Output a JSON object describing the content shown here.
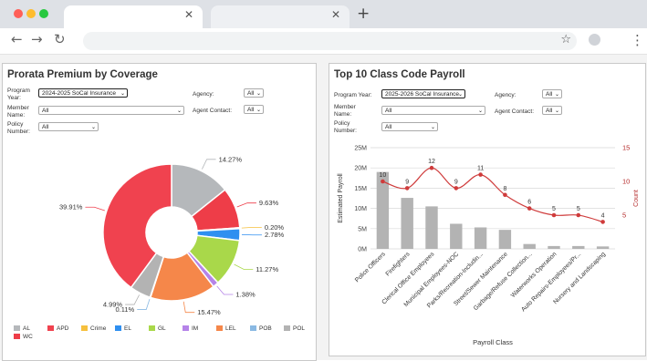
{
  "browser": {
    "tabs": [
      {
        "label": ""
      },
      {
        "label": ""
      }
    ],
    "address": "",
    "colors": {
      "close": "#ff5f57",
      "minimize": "#febc2e",
      "maximize": "#28c840"
    }
  },
  "left_panel": {
    "title": "Prorata Premium by Coverage",
    "filters": {
      "program_year_label": "Program Year:",
      "program_year_value": "2024-2025 SoCal Insurance",
      "agency_label": "Agency:",
      "agency_value": "All",
      "member_name_label": "Member Name:",
      "member_name_value": "All",
      "agent_contact_label": "Agent Contact:",
      "agent_contact_value": "All",
      "policy_number_label": "Policy Number:",
      "policy_number_value": "All"
    }
  },
  "right_panel": {
    "title": "Top 10 Class Code Payroll",
    "filters": {
      "program_year_label": "Program Year:",
      "program_year_value": "2025-2026 SoCal Insurance",
      "agency_label": "Agency:",
      "agency_value": "All",
      "member_name_label": "Member Name:",
      "member_name_value": "All",
      "agent_contact_label": "Agent Contact:",
      "agent_contact_value": "All",
      "policy_number_label": "Policy Number:",
      "policy_number_value": "All"
    }
  },
  "chart_data": [
    {
      "type": "pie",
      "title": "Prorata Premium by Coverage",
      "donut": true,
      "legend_position": "bottom",
      "series": [
        {
          "name": "AL",
          "color": "#b5b8bb"
        },
        {
          "name": "APD",
          "color": "#f0424f"
        },
        {
          "name": "Crime",
          "color": "#f6c03d"
        },
        {
          "name": "EL",
          "color": "#2f8ff0"
        },
        {
          "name": "GL",
          "color": "#a9d84a"
        },
        {
          "name": "IM",
          "color": "#b583e8"
        },
        {
          "name": "LEL",
          "color": "#f5874a"
        },
        {
          "name": "POB",
          "color": "#8ab9e3"
        },
        {
          "name": "POL",
          "color": "#b3b3b3"
        },
        {
          "name": "WC",
          "color": "#ee3d48"
        }
      ],
      "slices": [
        {
          "value": 14.27,
          "label": "14.27%",
          "color": "#b5b8bb"
        },
        {
          "value": 9.63,
          "label": "9.63%",
          "color": "#ee3d48"
        },
        {
          "value": 0.2,
          "label": "0.20%",
          "color": "#f6c03d"
        },
        {
          "value": 2.78,
          "label": "2.78%",
          "color": "#2f8ff0"
        },
        {
          "value": 11.27,
          "label": "11.27%",
          "color": "#a9d84a"
        },
        {
          "value": 1.38,
          "label": "1.38%",
          "color": "#b583e8"
        },
        {
          "value": 15.47,
          "label": "15.47%",
          "color": "#f5874a"
        },
        {
          "value": 0.11,
          "label": "0.11%",
          "color": "#8ab9e3"
        },
        {
          "value": 4.99,
          "label": "4.99%",
          "color": "#b3b3b3"
        },
        {
          "value": 39.91,
          "label": "39.91%",
          "color": "#f0424f"
        }
      ]
    },
    {
      "type": "bar",
      "title": "Top 10 Class Code Payroll",
      "xlabel": "Payroll Class",
      "ylabel": "Estimated Payroll",
      "y2label": "Count",
      "ylim": [
        0,
        25
      ],
      "yticks": [
        "0M",
        "5M",
        "10M",
        "15M",
        "20M",
        "25M"
      ],
      "y2lim": [
        0,
        15
      ],
      "y2ticks": [
        "5",
        "10",
        "15"
      ],
      "categories": [
        "Police Officers",
        "Firefighters",
        "Clerical Office Employees",
        "Municipal Employees-NOC",
        "Parks/Recreation-Includin...",
        "Street/Sewer Maintenance",
        "Garbage/Refuse Collection...",
        "Waterworks Operation",
        "Auto Repairs-Employees/Pr...",
        "Nursery and Landscaping"
      ],
      "series": [
        {
          "name": "",
          "kind": "bar",
          "color": "#b3b3b3",
          "values": [
            19,
            12.6,
            10.5,
            6.2,
            5.3,
            4.7,
            1.2,
            0.7,
            0.7,
            0.6
          ]
        },
        {
          "name": "",
          "kind": "line",
          "axis": "y2",
          "color": "#cf3b3b",
          "values": [
            10,
            9,
            12,
            9,
            11,
            8,
            6,
            5,
            5,
            4
          ]
        }
      ]
    }
  ]
}
